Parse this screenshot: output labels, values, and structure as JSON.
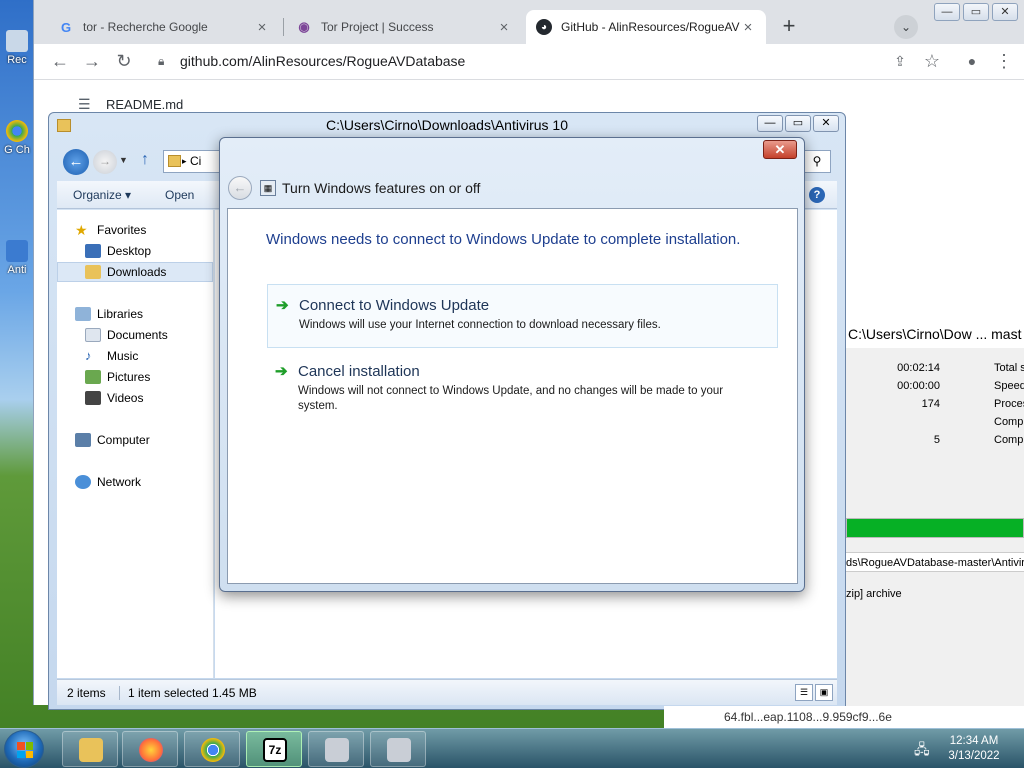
{
  "desktop": {
    "icons": [
      {
        "label": "Rec"
      },
      {
        "label": "G Ch"
      },
      {
        "label": "Anti"
      }
    ]
  },
  "browser": {
    "tabs": [
      {
        "label": "tor - Recherche Google",
        "icon": "google-icon"
      },
      {
        "label": "Tor Project | Success",
        "icon": "tor-onion-icon"
      },
      {
        "label": "GitHub - AlinResources/RogueAV",
        "icon": "github-icon"
      }
    ],
    "url": "github.com/AlinResources/RogueAVDatabase",
    "readme_label": "README.md"
  },
  "zip_panel": {
    "title": "C:\\Users\\Cirno\\Dow ... mast",
    "rows": [
      {
        "value": "00:02:14",
        "label": "Total s"
      },
      {
        "value": "00:00:00",
        "label": "Speed"
      },
      {
        "value": "174",
        "label": "Proces"
      },
      {
        "value": "",
        "label": "Compr"
      },
      {
        "value": "5",
        "label": "Compr"
      }
    ],
    "progress": 1.0,
    "path": "ds\\RogueAVDatabase-master\\Antivir",
    "archive_line": "zip] archive"
  },
  "explorer": {
    "title": "C:\\Users\\Cirno\\Downloads\\Antivirus 10",
    "address_crumb": "Ci",
    "commands": {
      "organize": "Organize ▾",
      "open": "Open"
    },
    "nav": {
      "favorites": "Favorites",
      "desktop": "Desktop",
      "downloads": "Downloads",
      "libraries": "Libraries",
      "documents": "Documents",
      "music": "Music",
      "pictures": "Pictures",
      "videos": "Videos",
      "computer": "Computer",
      "network": "Network"
    },
    "status": {
      "items": "2 items",
      "selected": "1 item selected  1.45 MB"
    }
  },
  "dialog": {
    "title": "Turn Windows features on or off",
    "message": "Windows needs to connect to Windows Update to complete installation.",
    "options": [
      {
        "title": "Connect to Windows Update",
        "desc": "Windows will use your Internet connection to download necessary files."
      },
      {
        "title": "Cancel installation",
        "desc": "Windows will not connect to Windows Update, and no changes will be made to your system."
      }
    ]
  },
  "background_strip": "64.fbl...eap.1108...9.959cf9...6e",
  "taskbar": {
    "time": "12:34 AM",
    "date": "3/13/2022",
    "apps": [
      "explorer",
      "firefox",
      "chrome",
      "7-zip",
      "installer",
      "installer"
    ]
  },
  "colors": {
    "accent": "#1e3f8f",
    "progress": "#06b025",
    "close_red": "#c4412b"
  }
}
